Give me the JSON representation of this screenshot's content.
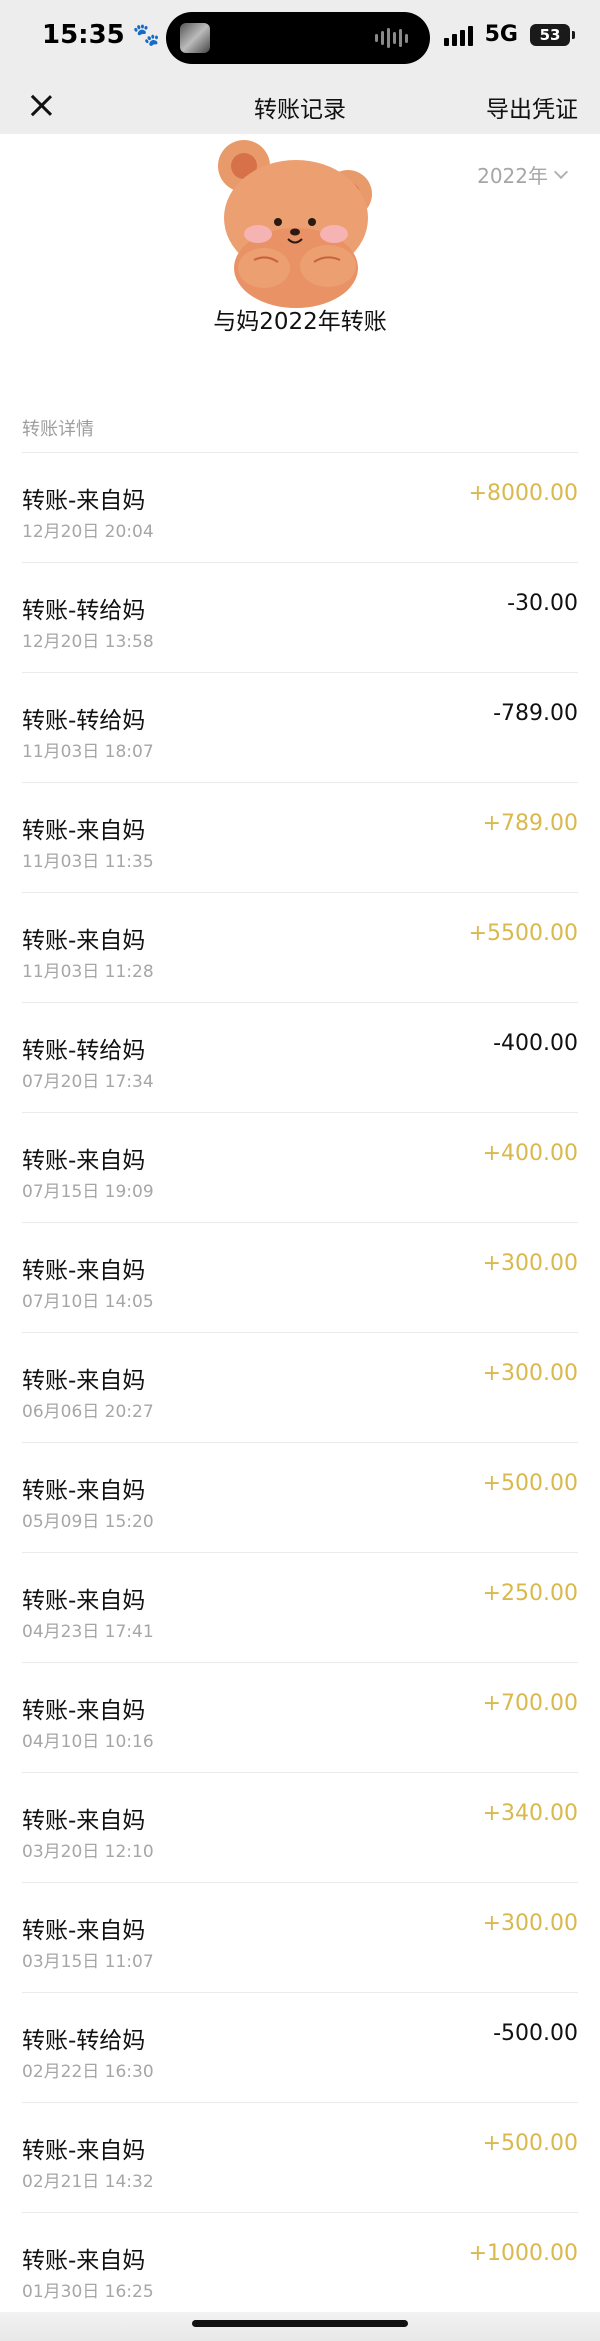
{
  "status_bar": {
    "time": "15:35",
    "network": "5G",
    "battery": "53"
  },
  "nav": {
    "title": "转账记录",
    "export_label": "导出凭证"
  },
  "header": {
    "year": "2022年",
    "caption": "与妈2022年转账"
  },
  "section_label": "转账详情",
  "colors": {
    "income_amount": "#d9b84c",
    "expense_amount": "#111111",
    "background": "#ededed"
  },
  "records": [
    {
      "title": "转账-来自妈",
      "time": "12月20日 20:04",
      "amount": "+8000.00",
      "direction": "in"
    },
    {
      "title": "转账-转给妈",
      "time": "12月20日 13:58",
      "amount": "-30.00",
      "direction": "out"
    },
    {
      "title": "转账-转给妈",
      "time": "11月03日 18:07",
      "amount": "-789.00",
      "direction": "out"
    },
    {
      "title": "转账-来自妈",
      "time": "11月03日 11:35",
      "amount": "+789.00",
      "direction": "in"
    },
    {
      "title": "转账-来自妈",
      "time": "11月03日 11:28",
      "amount": "+5500.00",
      "direction": "in"
    },
    {
      "title": "转账-转给妈",
      "time": "07月20日 17:34",
      "amount": "-400.00",
      "direction": "out"
    },
    {
      "title": "转账-来自妈",
      "time": "07月15日 19:09",
      "amount": "+400.00",
      "direction": "in"
    },
    {
      "title": "转账-来自妈",
      "time": "07月10日 14:05",
      "amount": "+300.00",
      "direction": "in"
    },
    {
      "title": "转账-来自妈",
      "time": "06月06日 20:27",
      "amount": "+300.00",
      "direction": "in"
    },
    {
      "title": "转账-来自妈",
      "time": "05月09日 15:20",
      "amount": "+500.00",
      "direction": "in"
    },
    {
      "title": "转账-来自妈",
      "time": "04月23日 17:41",
      "amount": "+250.00",
      "direction": "in"
    },
    {
      "title": "转账-来自妈",
      "time": "04月10日 10:16",
      "amount": "+700.00",
      "direction": "in"
    },
    {
      "title": "转账-来自妈",
      "time": "03月20日 12:10",
      "amount": "+340.00",
      "direction": "in"
    },
    {
      "title": "转账-来自妈",
      "time": "03月15日 11:07",
      "amount": "+300.00",
      "direction": "in"
    },
    {
      "title": "转账-转给妈",
      "time": "02月22日 16:30",
      "amount": "-500.00",
      "direction": "out"
    },
    {
      "title": "转账-来自妈",
      "time": "02月21日 14:32",
      "amount": "+500.00",
      "direction": "in"
    },
    {
      "title": "转账-来自妈",
      "time": "01月30日 16:25",
      "amount": "+1000.00",
      "direction": "in"
    }
  ]
}
